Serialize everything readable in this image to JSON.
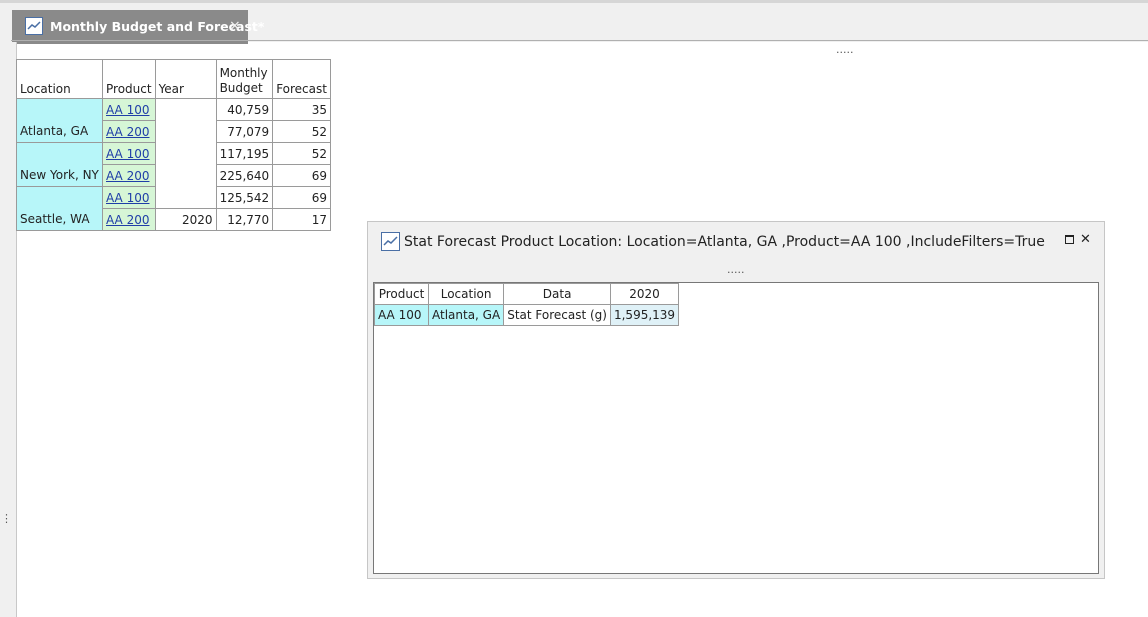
{
  "tab": {
    "title": "Monthly Budget and Forecast*",
    "close": "×"
  },
  "splitter": {
    "top_dots": ".....",
    "popup_dots": ".....",
    "grip": "⋮"
  },
  "main_grid": {
    "headers": {
      "location": "Location",
      "product": "Product",
      "year": "Year",
      "budget": "Monthly Budget",
      "forecast": "Forecast"
    },
    "rows": [
      {
        "location": "",
        "product": "AA 100",
        "year": "",
        "budget": "40,759",
        "forecast": "35"
      },
      {
        "location": "Atlanta, GA",
        "product": "AA 200",
        "year": "",
        "budget": "77,079",
        "forecast": "52"
      },
      {
        "location": "",
        "product": "AA 100",
        "year": "",
        "budget": "117,195",
        "forecast": "52"
      },
      {
        "location": "New York, NY",
        "product": "AA 200",
        "year": "",
        "budget": "225,640",
        "forecast": "69"
      },
      {
        "location": "",
        "product": "AA 100",
        "year": "",
        "budget": "125,542",
        "forecast": "69"
      },
      {
        "location": "Seattle, WA",
        "product": "AA 200",
        "year": "2020",
        "budget": "12,770",
        "forecast": "17"
      }
    ]
  },
  "popup": {
    "title": "Stat Forecast Product Location: Location=Atlanta, GA ,Product=AA 100 ,IncludeFilters=True",
    "close": "✕",
    "grid": {
      "headers": {
        "product": "Product",
        "location": "Location",
        "data": "Data",
        "year": "2020"
      },
      "row": {
        "product": "AA 100",
        "location": "Atlanta, GA",
        "data": "Stat Forecast (g)",
        "value": "1,595,139"
      }
    }
  },
  "icons": {
    "tab": "line-chart-icon",
    "popup": "line-chart-icon",
    "maximize": "maximize-icon",
    "close": "close-icon"
  },
  "colors": {
    "location_cell": "#b7f6f9",
    "product_cell": "#d6f6d6",
    "link": "#1f3ea8",
    "tab_bg": "#8a8a8a"
  }
}
